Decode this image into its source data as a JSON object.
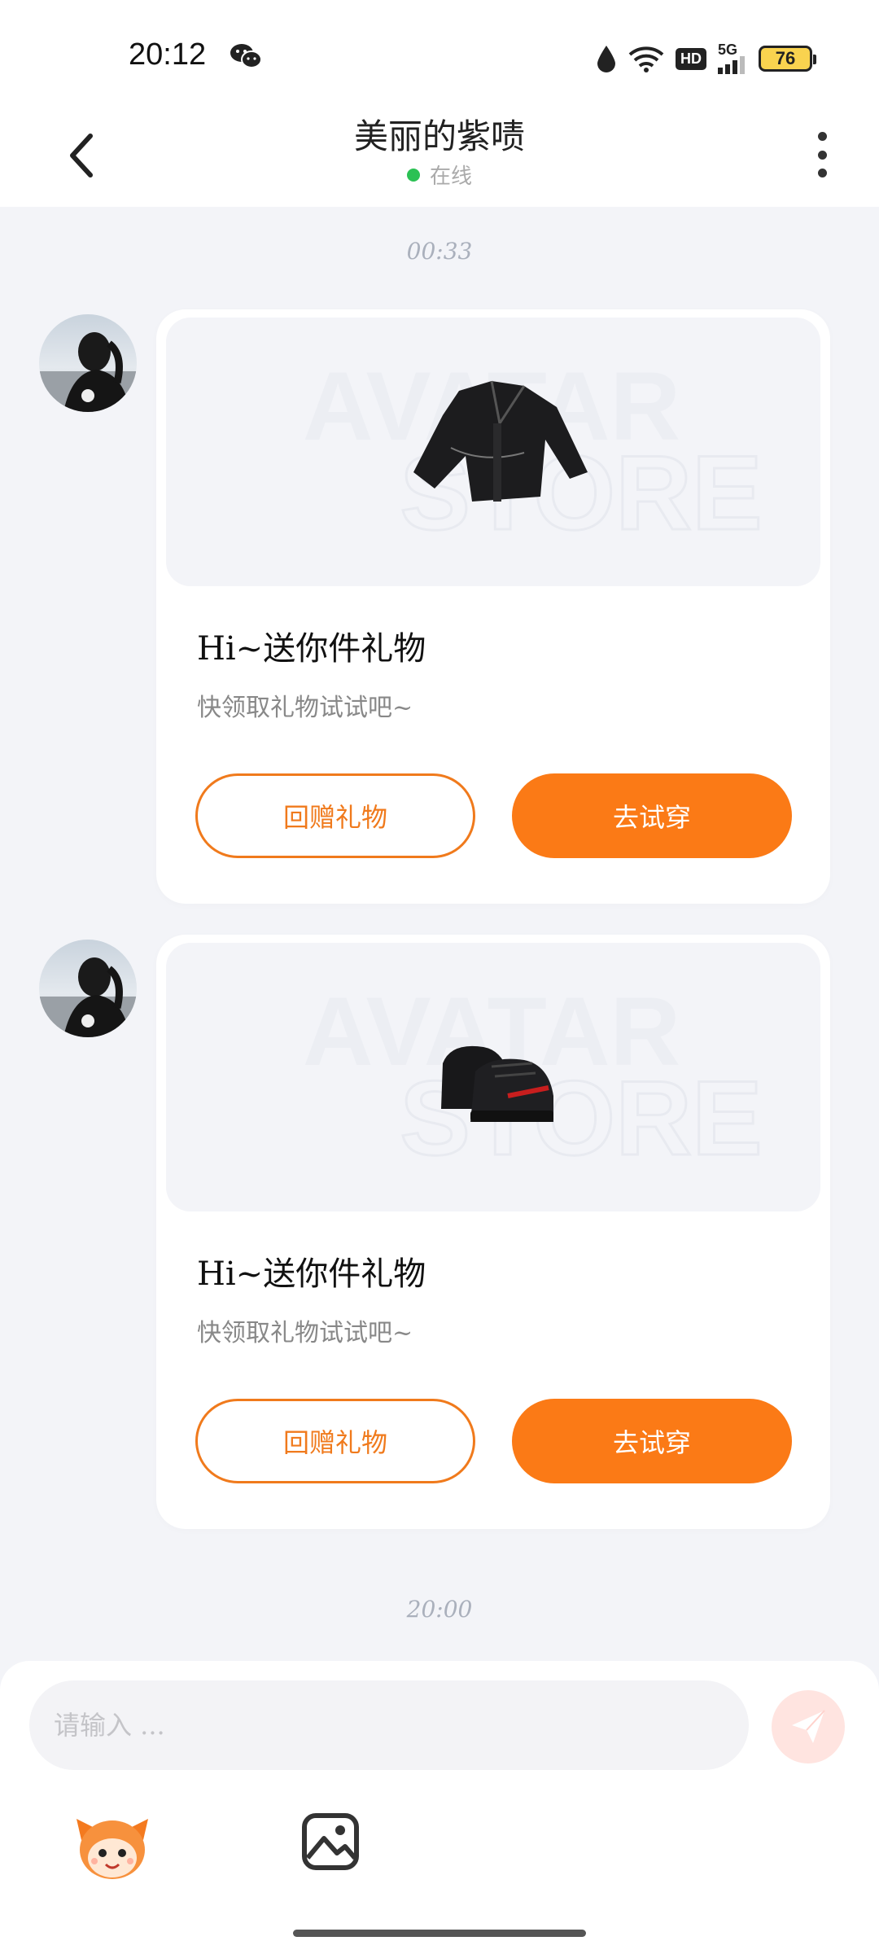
{
  "status_bar": {
    "time": "20:12",
    "hd_label": "HD",
    "network_label": "5G",
    "battery_level": "76",
    "icons": [
      "wechat-icon",
      "water-drop-icon",
      "wifi-icon",
      "hd-icon",
      "signal-5g-icon",
      "battery-icon"
    ]
  },
  "header": {
    "title": "美丽的紫啧",
    "status": "在线",
    "status_color": "#2bc154",
    "back_icon": "chevron-left-icon",
    "more_icon": "more-vertical-icon"
  },
  "messages": [
    {
      "timestamp": "00:33",
      "card": {
        "item": "jacket",
        "title": "Hi~送你件礼物",
        "subtitle": "快领取礼物试试吧~",
        "secondary_button": "回赠礼物",
        "primary_button": "去试穿"
      }
    },
    {
      "card": {
        "item": "shoes",
        "title": "Hi~送你件礼物",
        "subtitle": "快领取礼物试试吧~",
        "secondary_button": "回赠礼物",
        "primary_button": "去试穿"
      }
    },
    {
      "timestamp": "20:00"
    }
  ],
  "watermark_text": [
    "AVATAR",
    "STORE"
  ],
  "composer": {
    "placeholder": "请输入 ...",
    "send_icon": "send-icon",
    "mascot_icon": "mascot-icon",
    "image_icon": "image-icon"
  },
  "colors": {
    "accent": "#fb7a16",
    "background": "#f3f4f8"
  }
}
